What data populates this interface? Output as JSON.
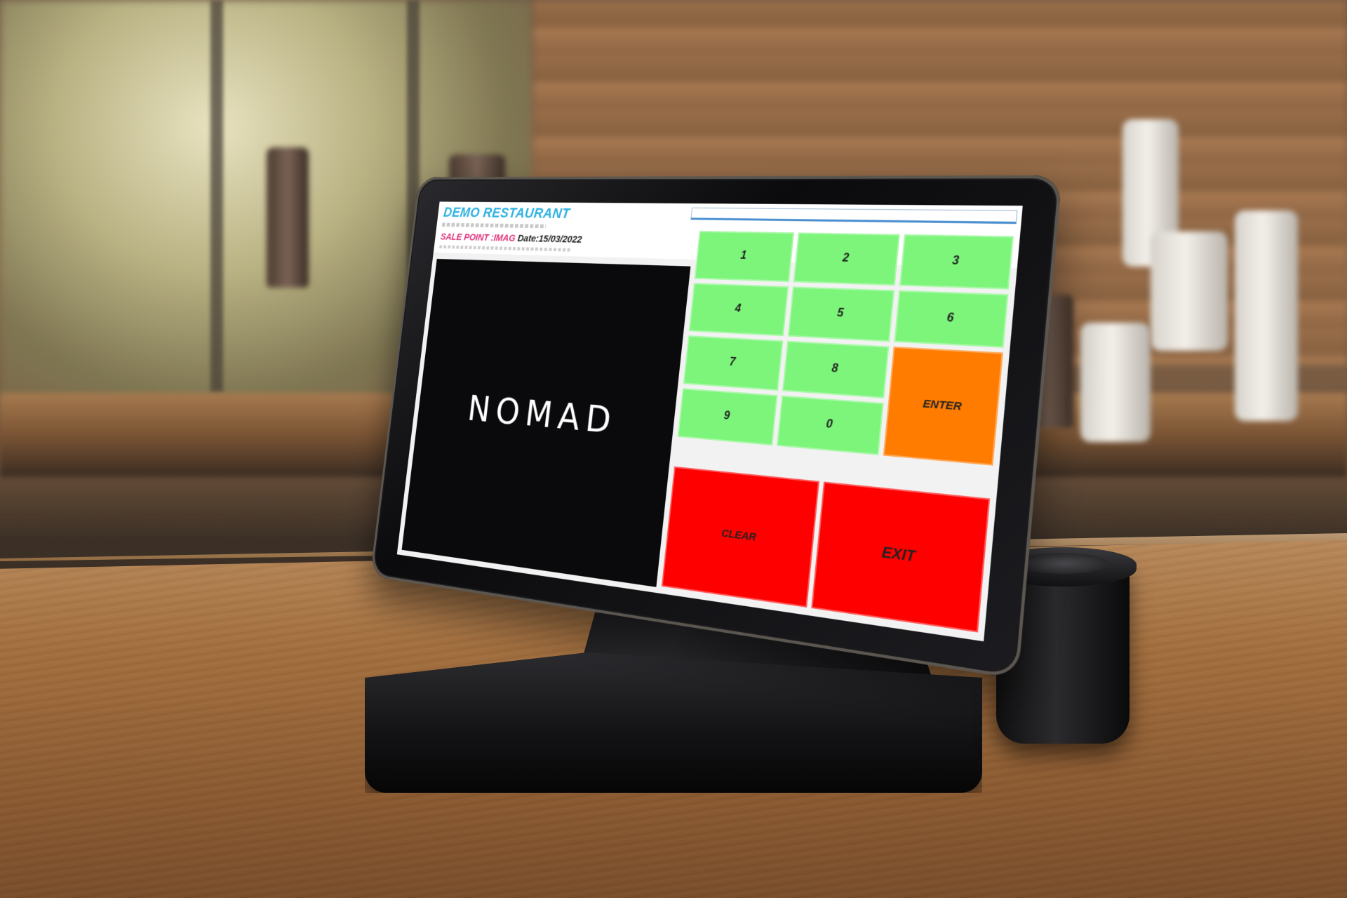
{
  "app": {
    "restaurant_name": "DEMO RESTAURANT",
    "sale_point_label": "SALE POINT :IMAG",
    "date_text": "Date:15/03/2022",
    "logo_text": "NOMAD"
  },
  "keypad": {
    "keys": [
      "1",
      "2",
      "3",
      "4",
      "5",
      "6",
      "7",
      "8",
      "9",
      "0"
    ],
    "enter_label": "ENTER",
    "clear_label": "CLEAR",
    "exit_label": "EXIT"
  },
  "colors": {
    "number_key": "#7cf57a",
    "enter_key": "#ff7c00",
    "clear_exit_key": "#ff0000",
    "title_blue": "#2ab0e0",
    "sale_point_pink": "#e0307a"
  }
}
